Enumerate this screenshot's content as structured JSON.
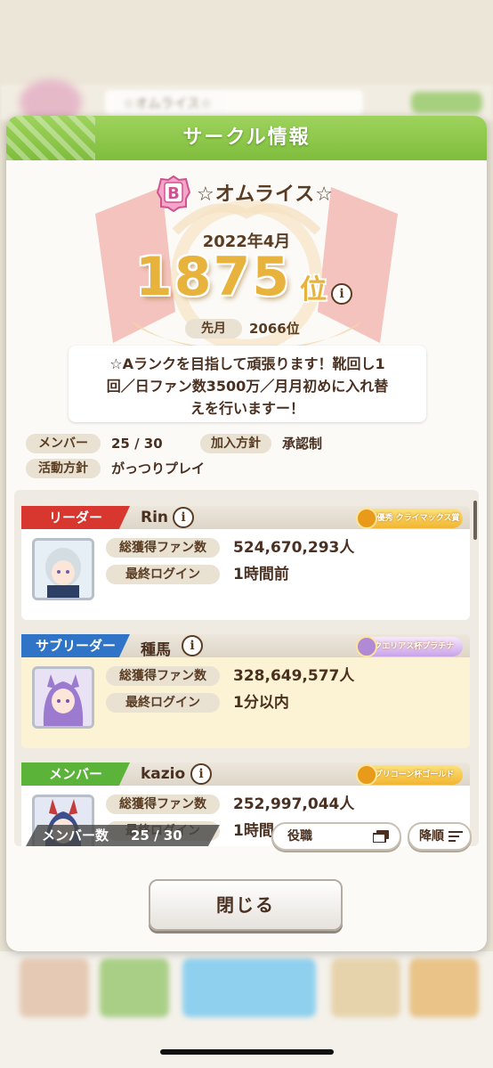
{
  "background": {
    "circle_name": "☆オムライス☆"
  },
  "dialog": {
    "title": "サークル情報",
    "rank_badge": "B",
    "circle_name": "☆オムライス☆",
    "period": "2022年4月",
    "rank": "1875",
    "rank_suffix": "位",
    "info_glyph": "i",
    "last_month_label": "先月",
    "last_month_value": "2066位",
    "description_lines": [
      "☆Aランクを目指して頑張ります！靴回し1",
      "回／日ファン数3500万／月月初めに入れ替",
      "えを行いますー！"
    ],
    "members_label": "メンバー",
    "members_value": "25 / 30",
    "join_policy_label": "加入方針",
    "join_policy_value": "承認制",
    "activity_label": "活動方針",
    "activity_value": "がっつりプレイ",
    "fans_label": "総獲得ファン数",
    "login_label": "最終ログイン",
    "members": [
      {
        "role": "リーダー",
        "name": "Rin",
        "award": "成績優秀 クライマックス賞",
        "fans": "524,670,293人",
        "last_login": "1時間前"
      },
      {
        "role": "サブリーダー",
        "name": "種馬",
        "award": "アクエリアス杯プラチナ",
        "fans": "328,649,577人",
        "last_login": "1分以内"
      },
      {
        "role": "メンバー",
        "name": "kazio",
        "award": "カプリコーン杯ゴールド",
        "fans": "252,997,044人",
        "last_login": "1時間"
      }
    ],
    "member_count_label": "メンバー数",
    "member_count_value": "25 / 30",
    "filter_label": "役職",
    "sort_label": "降順",
    "close_label": "閉じる"
  },
  "colors": {
    "header_green": "#8cc84b",
    "leader_red": "#d7372e",
    "subleader_blue": "#2f74c7",
    "member_green": "#5bb33a",
    "rank_gold": "#e7b33c"
  }
}
